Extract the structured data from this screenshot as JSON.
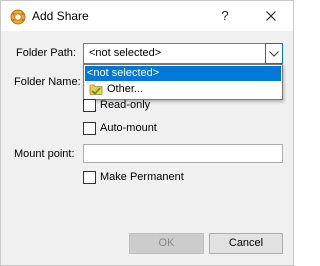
{
  "window": {
    "title": "Add Share",
    "help_label": "?",
    "app_icon": "virtualbox-icon",
    "close_icon": "close-icon"
  },
  "form": {
    "folder_path_label": "Folder Path:",
    "folder_path_value": "<not selected>",
    "folder_name_label": "Folder Name:",
    "read_only_label": "Read-only",
    "read_only_checked": false,
    "auto_mount_label": "Auto-mount",
    "auto_mount_checked": false,
    "mount_point_label": "Mount point:",
    "mount_point_value": "",
    "make_permanent_label": "Make Permanent",
    "make_permanent_checked": false
  },
  "dropdown": {
    "options": [
      "<not selected>",
      "Other..."
    ],
    "selected_index": 0,
    "other_icon": "folder-icon"
  },
  "buttons": {
    "ok_label": "OK",
    "ok_enabled": false,
    "cancel_label": "Cancel"
  },
  "colors": {
    "accent": "#0078d7",
    "dialog_bg": "#f0f0f0"
  }
}
